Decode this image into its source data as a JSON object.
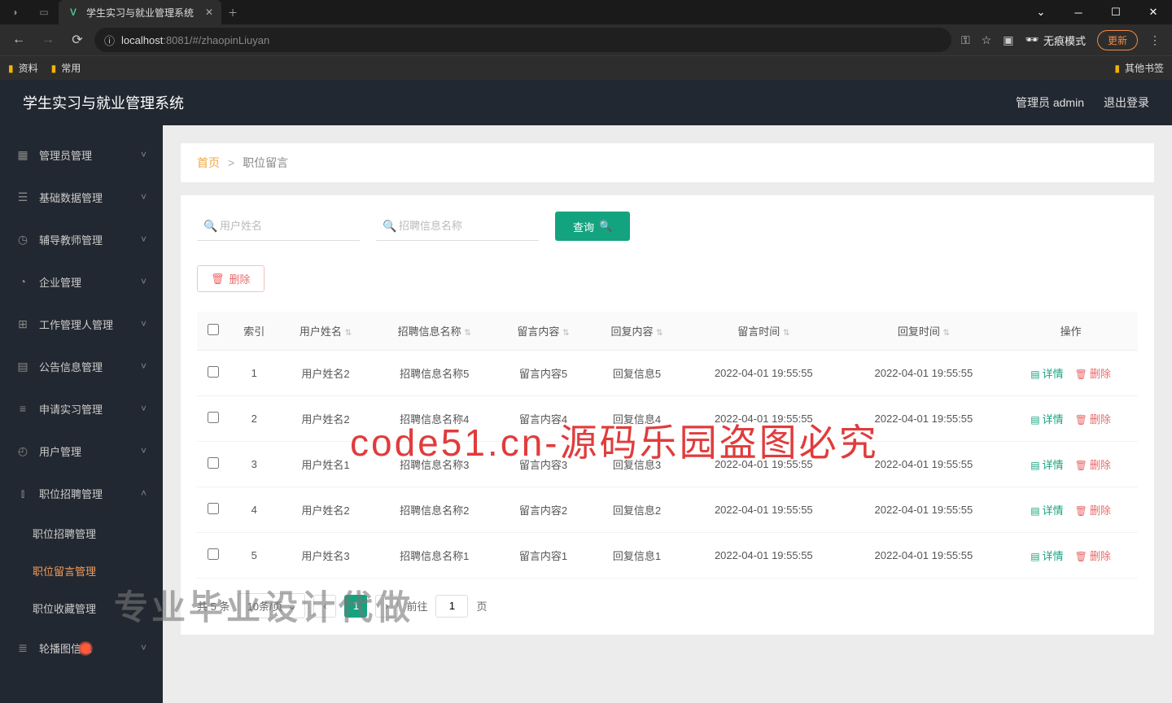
{
  "browser": {
    "tab_title": "学生实习与就业管理系统",
    "url_host": "localhost",
    "url_port": ":8081",
    "url_path": "/#/zhaopinLiuyan",
    "bm1": "资料",
    "bm2": "常用",
    "bm_other": "其他书签",
    "incognito": "无痕模式",
    "update": "更新"
  },
  "header": {
    "app_title": "学生实习与就业管理系统",
    "user": "管理员 admin",
    "logout": "退出登录"
  },
  "sidebar": {
    "items": [
      {
        "label": "管理员管理",
        "icon": "▦"
      },
      {
        "label": "基础数据管理",
        "icon": "☰"
      },
      {
        "label": "辅导教师管理",
        "icon": "◷"
      },
      {
        "label": "企业管理",
        "icon": "◔"
      },
      {
        "label": "工作管理人管理",
        "icon": "⊞"
      },
      {
        "label": "公告信息管理",
        "icon": "▤"
      },
      {
        "label": "申请实习管理",
        "icon": "≡"
      },
      {
        "label": "用户管理",
        "icon": "◴"
      },
      {
        "label": "职位招聘管理",
        "icon": "⫾"
      }
    ],
    "subs": [
      {
        "label": "职位招聘管理"
      },
      {
        "label": "职位留言管理"
      },
      {
        "label": "职位收藏管理"
      }
    ],
    "last": {
      "label": "轮播图信息",
      "icon": "≣"
    }
  },
  "crumb": {
    "home": "首页",
    "sep": ">",
    "cur": "职位留言"
  },
  "filter": {
    "ph1": "用户姓名",
    "ph2": "招聘信息名称",
    "query": "查询"
  },
  "delbtn": "删除",
  "cols": {
    "idx": "索引",
    "user": "用户姓名",
    "job": "招聘信息名称",
    "msg": "留言内容",
    "reply": "回复内容",
    "mtime": "留言时间",
    "rtime": "回复时间",
    "op": "操作"
  },
  "rows": [
    {
      "idx": "1",
      "user": "用户姓名2",
      "job": "招聘信息名称5",
      "msg": "留言内容5",
      "reply": "回复信息5",
      "mtime": "2022-04-01 19:55:55",
      "rtime": "2022-04-01 19:55:55"
    },
    {
      "idx": "2",
      "user": "用户姓名2",
      "job": "招聘信息名称4",
      "msg": "留言内容4",
      "reply": "回复信息4",
      "mtime": "2022-04-01 19:55:55",
      "rtime": "2022-04-01 19:55:55"
    },
    {
      "idx": "3",
      "user": "用户姓名1",
      "job": "招聘信息名称3",
      "msg": "留言内容3",
      "reply": "回复信息3",
      "mtime": "2022-04-01 19:55:55",
      "rtime": "2022-04-01 19:55:55"
    },
    {
      "idx": "4",
      "user": "用户姓名2",
      "job": "招聘信息名称2",
      "msg": "留言内容2",
      "reply": "回复信息2",
      "mtime": "2022-04-01 19:55:55",
      "rtime": "2022-04-01 19:55:55"
    },
    {
      "idx": "5",
      "user": "用户姓名3",
      "job": "招聘信息名称1",
      "msg": "留言内容1",
      "reply": "回复信息1",
      "mtime": "2022-04-01 19:55:55",
      "rtime": "2022-04-01 19:55:55"
    }
  ],
  "ops": {
    "detail": "详情",
    "del": "删除"
  },
  "pager": {
    "total": "共 5 条",
    "size": "10条/页",
    "goto": "前往",
    "page": "1",
    "unit": "页"
  },
  "wm1": "code51.cn-源码乐园盗图必究",
  "wm2": "专业毕业设计代做"
}
